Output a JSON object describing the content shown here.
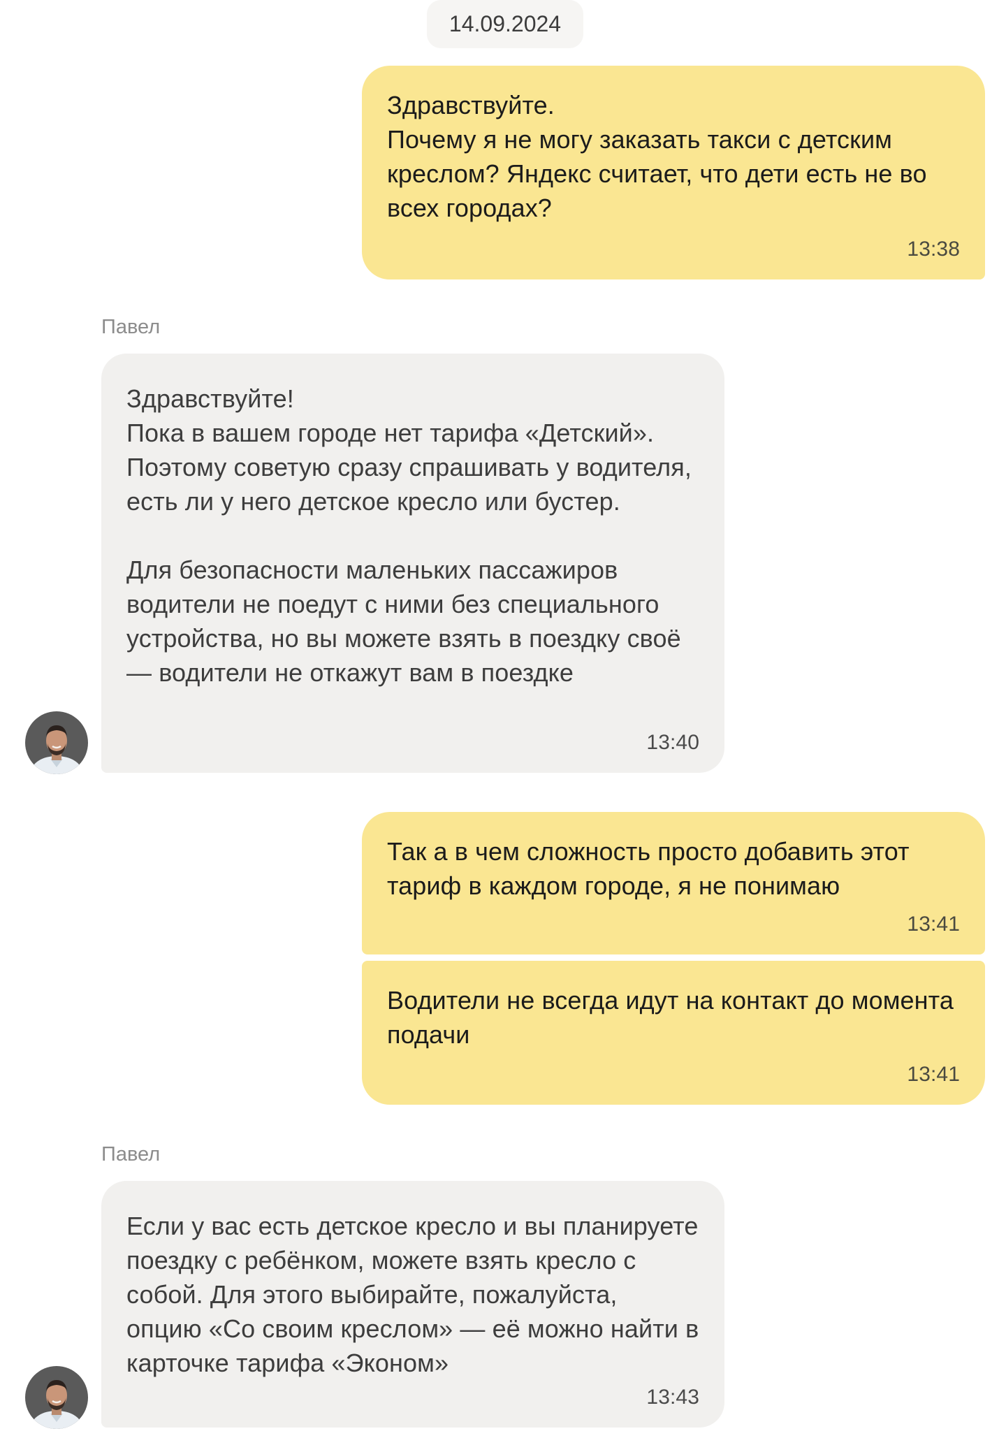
{
  "date_separator": "14.09.2024",
  "messages": [
    {
      "text": "Здравствуйте.\nПочему я не могу заказать такси с детским креслом? Яндекс считает, что дети есть не во всех городах?",
      "time": "13:38"
    },
    {
      "sender": "Павел",
      "text": "Здравствуйте!\nПока в вашем городе нет тарифа «Детский». Поэтому советую сразу спрашивать у водителя, есть ли у него детское кресло или бустер.\n\nДля безопасности маленьких пассажиров водители не поедут с ними без специального устройства, но вы можете взять в поездку своё — водители не откажут вам в поездке",
      "time": "13:40"
    },
    {
      "text": "Так а в чем сложность просто добавить этот тариф в каждом городе, я не понимаю",
      "time": "13:41"
    },
    {
      "text": "Водители не всегда идут на контакт до момента подачи",
      "time": "13:41"
    },
    {
      "sender": "Павел",
      "text": "Если у вас есть детское кресло и вы планируете поездку с ребёнком, можете взять кресло с собой. Для этого выбирайте, пожалуйста, опцию «Со своим креслом» — её можно найти в карточке тарифа «Эконом»",
      "time": "13:43"
    }
  ],
  "colors": {
    "outgoing_bubble": "#fae692",
    "incoming_bubble": "#f1f0ee",
    "date_pill": "#f6f5f3",
    "sender_name": "#8c8c8c"
  },
  "icons": {
    "operator_avatar": "operator-avatar-photo"
  }
}
